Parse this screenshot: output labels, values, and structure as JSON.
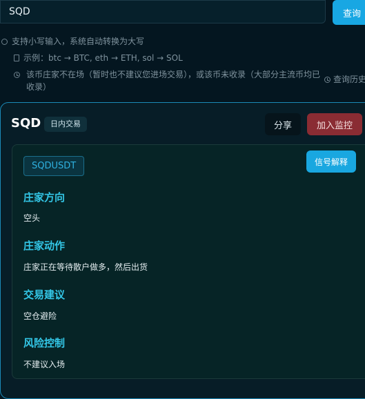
{
  "search": {
    "value": "SQD",
    "button_label": "查询"
  },
  "hints": {
    "uppercase_note": "支持小写输入，系统自动转换为大写",
    "example_note": "示例：btc → BTC, eth → ETH, sol → SOL",
    "not_listed_note": "该币庄家不在场（暂时也不建议您进场交易），或该币未收录（大部分主流币均已收录）",
    "history_link": "查询历史"
  },
  "result": {
    "symbol": "SQD",
    "mode_badge": "日内交易",
    "share_label": "分享",
    "watch_label": "加入监控",
    "pair": "SQDUSDT",
    "explain_label": "信号解释",
    "sections": [
      {
        "title": "庄家方向",
        "value": "空头"
      },
      {
        "title": "庄家动作",
        "value": "庄家正在等待散户做多，然后出货"
      },
      {
        "title": "交易建议",
        "value": "空仓避险"
      },
      {
        "title": "风险控制",
        "value": "不建议入场"
      }
    ]
  },
  "colors": {
    "accent": "#19a7e0",
    "section_title": "#33c6e6",
    "watch_button": "#8a2c33",
    "background": "#041620"
  }
}
